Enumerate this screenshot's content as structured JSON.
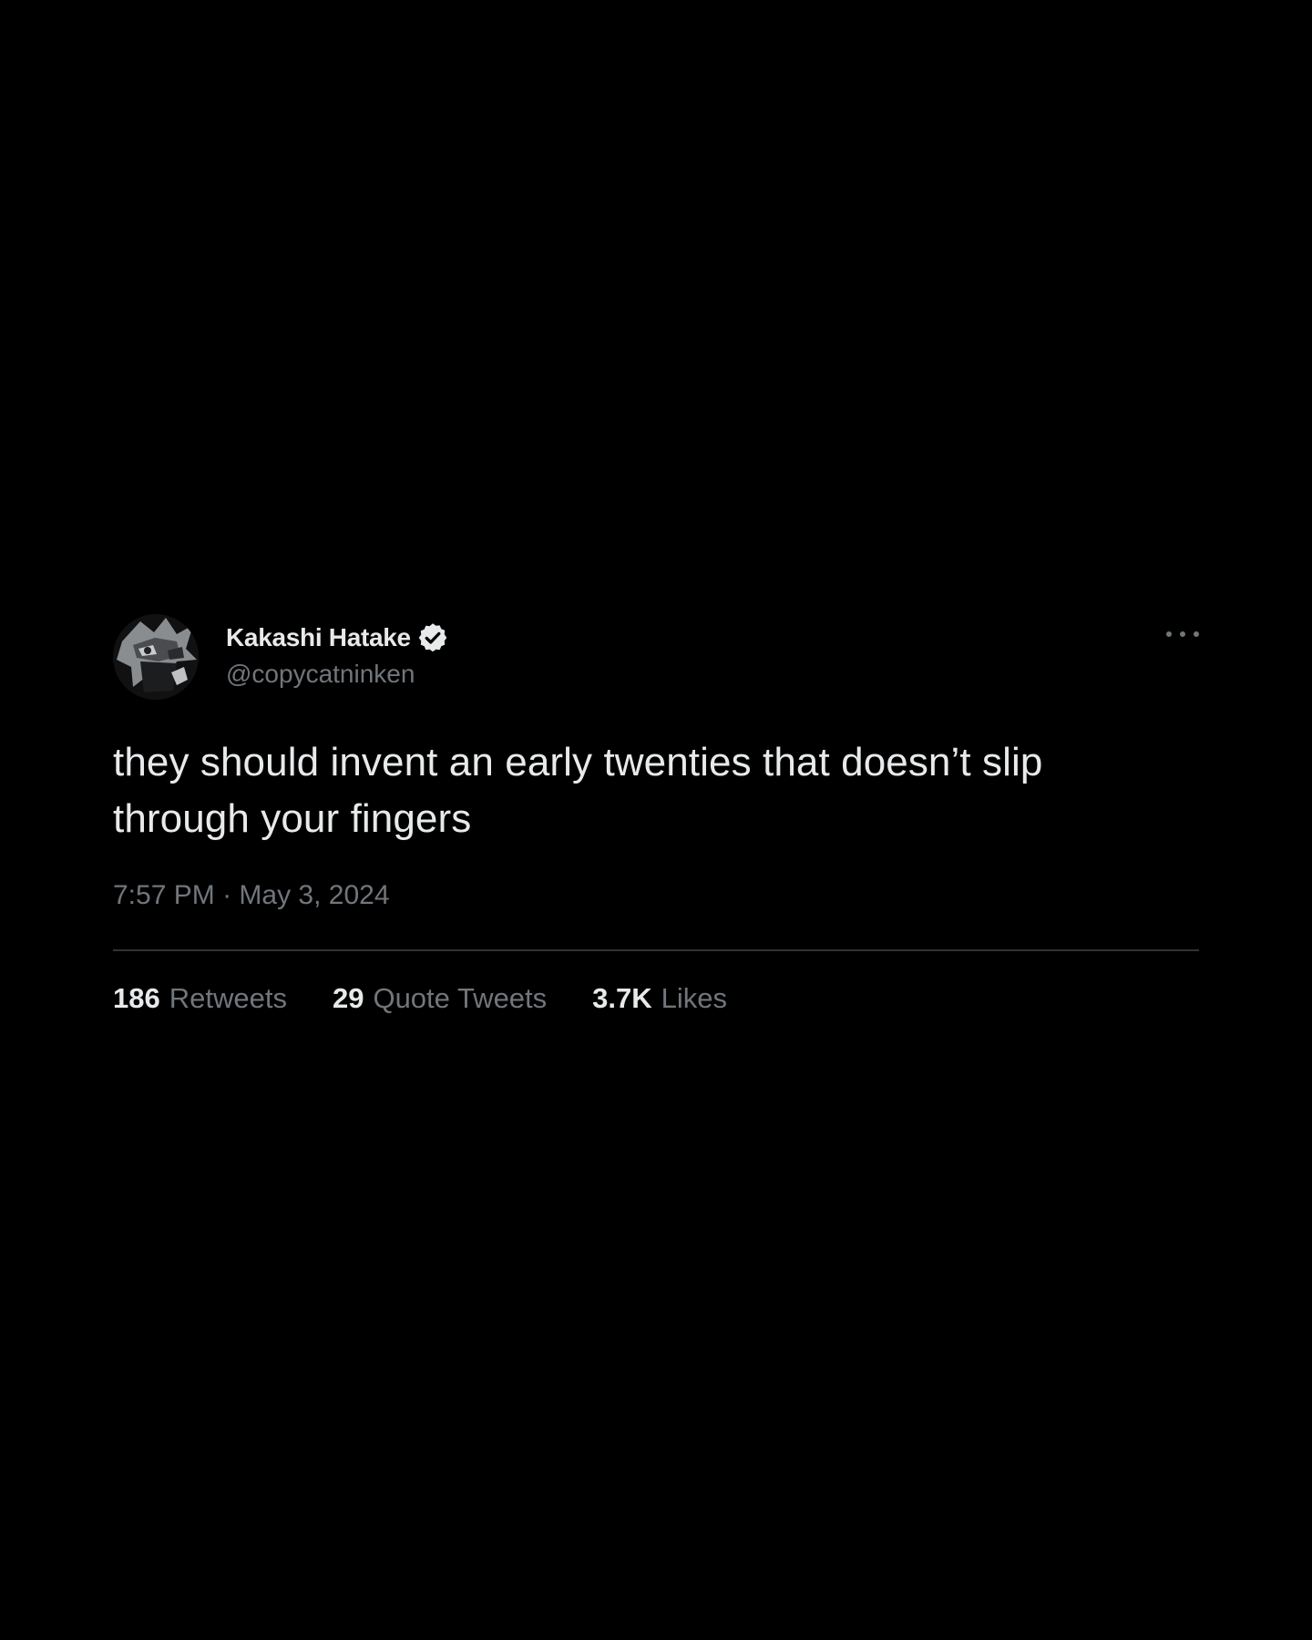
{
  "tweet": {
    "author": {
      "display_name": "Kakashi Hatake",
      "handle": "@copycatninken",
      "verified": true,
      "avatar_icon": "avatar-kakashi"
    },
    "text_lines": [
      "they should invent an early twenties that doesn’t slip",
      "through your fingers"
    ],
    "time": "7:57 PM",
    "separator": "·",
    "date": "May 3, 2024",
    "stats": {
      "retweets_count": "186",
      "retweets_label": "Retweets",
      "quotes_count": "29",
      "quotes_label": "Quote Tweets",
      "likes_count": "3.7K",
      "likes_label": "Likes"
    }
  },
  "colors": {
    "background": "#000000",
    "primary_text": "#e7e9ea",
    "secondary_text": "#71767b",
    "divider": "#2f3336"
  }
}
